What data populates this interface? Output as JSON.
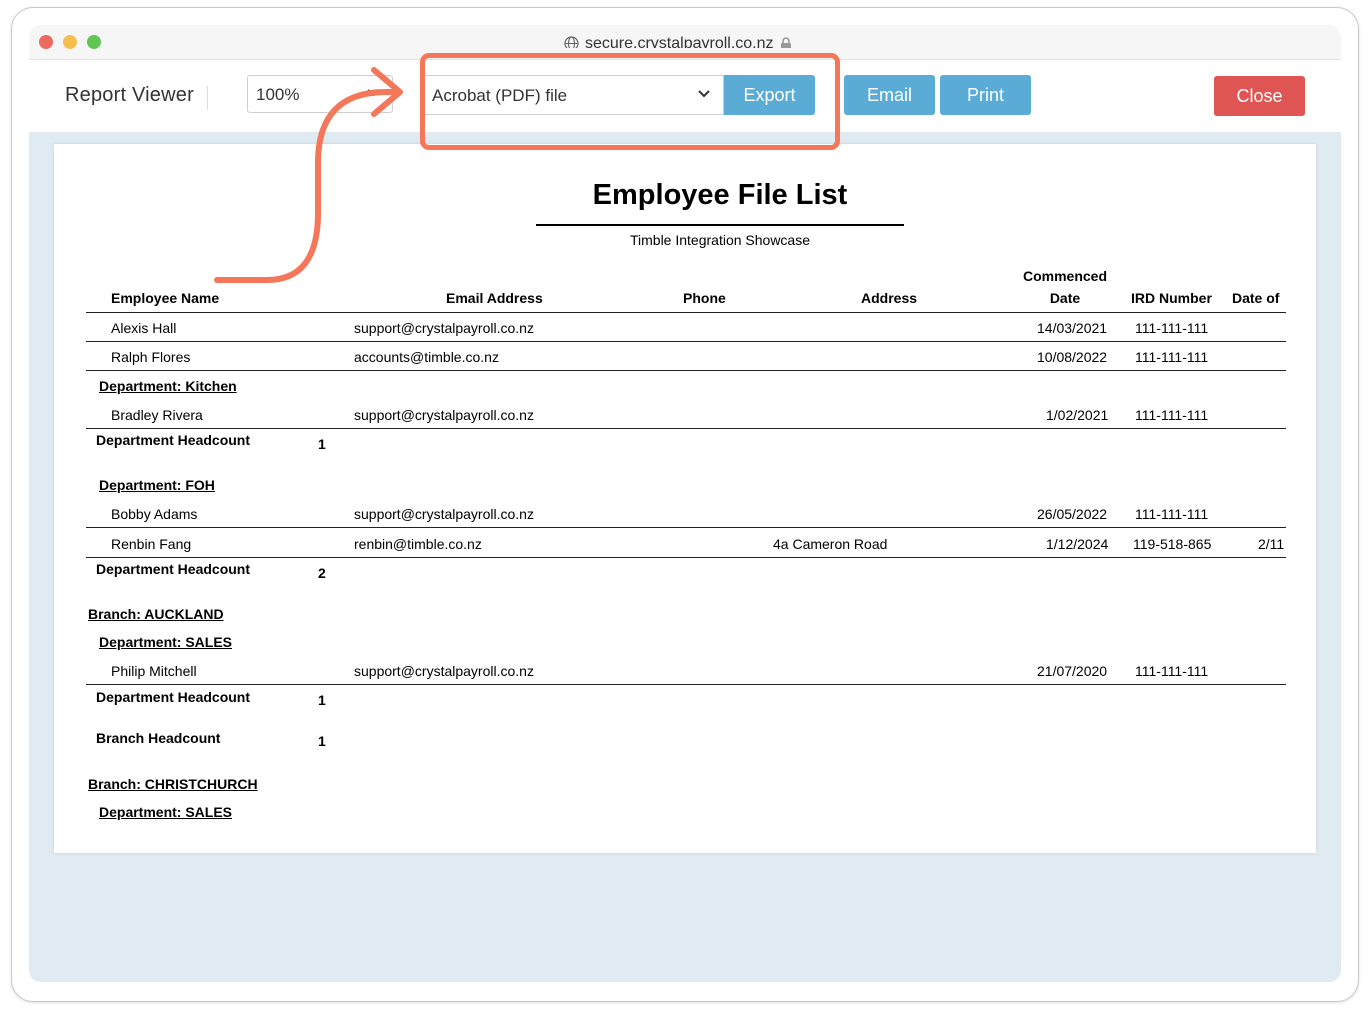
{
  "browser": {
    "url": "secure.crystalpayroll.co.nz"
  },
  "toolbar": {
    "app_title": "Report Viewer",
    "zoom_value": "100%",
    "format_value": "Acrobat (PDF) file",
    "export_label": "Export",
    "email_label": "Email",
    "print_label": "Print",
    "close_label": "Close"
  },
  "colors": {
    "button_blue": "#5aacd7",
    "close_red": "#df5553",
    "highlight_orange": "#f5775a",
    "viewer_bg": "#dfeaf1"
  },
  "report": {
    "title": "Employee File List",
    "subtitle": "Timble Integration Showcase",
    "columns": {
      "employee_name": "Employee Name",
      "email": "Email Address",
      "phone": "Phone",
      "address": "Address",
      "commenced_1": "Commenced",
      "commenced_2": "Date",
      "ird": "IRD Number",
      "date_of": "Date of"
    },
    "rows": [
      {
        "name": "Alexis Hall",
        "email": "support@crystalpayroll.co.nz",
        "address": "",
        "commenced": "14/03/2021",
        "ird": "111-111-111",
        "date_of": ""
      },
      {
        "name": "Ralph Flores",
        "email": "accounts@timble.co.nz",
        "address": "",
        "commenced": "10/08/2022",
        "ird": "111-111-111",
        "date_of": ""
      },
      {
        "name": "Bradley Rivera",
        "email": "support@crystalpayroll.co.nz",
        "address": "",
        "commenced": "1/02/2021",
        "ird": "111-111-111",
        "date_of": ""
      },
      {
        "name": "Bobby Adams",
        "email": "support@crystalpayroll.co.nz",
        "address": "",
        "commenced": "26/05/2022",
        "ird": "111-111-111",
        "date_of": ""
      },
      {
        "name": "Renbin Fang",
        "email": "renbin@timble.co.nz",
        "address": "4a Cameron Road",
        "commenced": "1/12/2024",
        "ird": "119-518-865",
        "date_of": "2/11"
      },
      {
        "name": "Philip Mitchell",
        "email": "support@crystalpayroll.co.nz",
        "address": "",
        "commenced": "21/07/2020",
        "ird": "111-111-111",
        "date_of": ""
      }
    ],
    "dept_kitchen": "Department: Kitchen",
    "dept_foh": "Department: FOH",
    "dept_sales_1": "Department: SALES",
    "dept_sales_2": "Department: SALES",
    "branch_auckland": "Branch: AUCKLAND",
    "branch_christchurch": "Branch: CHRISTCHURCH",
    "dept_headcount_label": "Department Headcount",
    "branch_headcount_label": "Branch Headcount",
    "headcount_kitchen": "1",
    "headcount_foh": "2",
    "headcount_sales": "1",
    "headcount_auckland": "1"
  }
}
